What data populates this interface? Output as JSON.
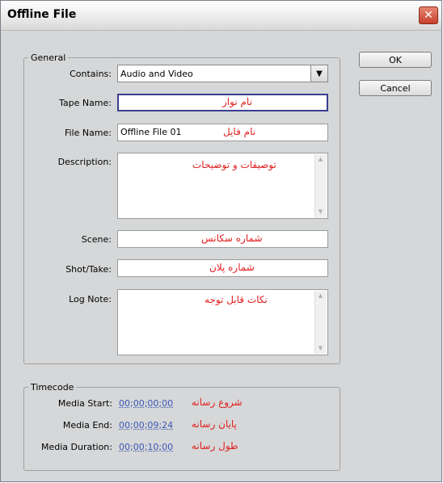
{
  "window": {
    "title": "Offline File",
    "close_glyph": "✕"
  },
  "buttons": {
    "ok": "OK",
    "cancel": "Cancel"
  },
  "general": {
    "legend": "General",
    "contains_label": "Contains:",
    "contains_value": "Audio and Video",
    "tape_name_label": "Tape Name:",
    "tape_name_value": "",
    "tape_name_annotation": "نام نوار",
    "file_name_label": "File Name:",
    "file_name_value": "Offline File 01",
    "file_name_annotation": "نام فایل",
    "description_label": "Description:",
    "description_annotation": "توصیفات و توضیحات",
    "scene_label": "Scene:",
    "scene_annotation": "شماره سکانس",
    "shot_label": "Shot/Take:",
    "shot_annotation": "شماره پلان",
    "lognote_label": "Log Note:",
    "lognote_annotation": "نکات قابل توجه"
  },
  "timecode": {
    "legend": "Timecode",
    "media_start_label": "Media Start:",
    "media_start_value": "00;00;00;00",
    "media_start_annotation": "شروع رسانه",
    "media_end_label": "Media End:",
    "media_end_value": "00;00;09;24",
    "media_end_annotation": "پایان رسانه",
    "media_duration_label": "Media Duration:",
    "media_duration_value": "00;00;10;00",
    "media_duration_annotation": "طول رسانه"
  },
  "colors": {
    "annotation": "#e02020",
    "timecode": "#3a57b8",
    "focus_border": "#3a3f8f"
  }
}
